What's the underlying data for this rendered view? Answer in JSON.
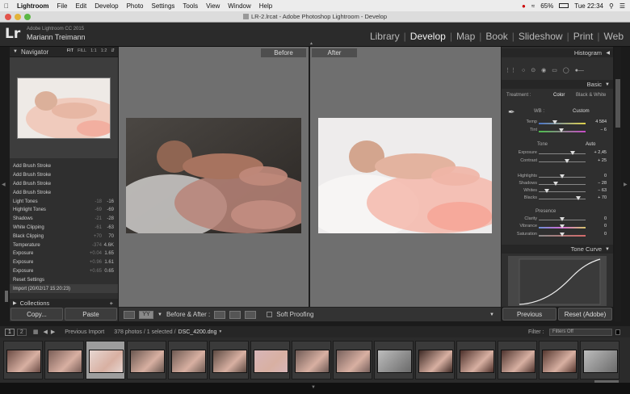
{
  "menubar": {
    "app": "Lightroom",
    "items": [
      "File",
      "Edit",
      "Develop",
      "Photo",
      "Settings",
      "Tools",
      "View",
      "Window",
      "Help"
    ],
    "battery": "65%",
    "clock": "Tue 22:34"
  },
  "window": {
    "title": "LR-2.lrcat - Adobe Photoshop Lightroom - Develop"
  },
  "identity": {
    "logo": "Lr",
    "version": "Adobe Lightroom CC 2015",
    "user": "Mariann Treimann",
    "modules": [
      "Library",
      "Develop",
      "Map",
      "Book",
      "Slideshow",
      "Print",
      "Web"
    ],
    "active_module": "Develop"
  },
  "navigator": {
    "title": "Navigator",
    "zoom_options": [
      "FIT",
      "FILL",
      "1:1",
      "1:2"
    ]
  },
  "history": [
    {
      "label": "Add Brush Stroke",
      "v1": "",
      "v2": ""
    },
    {
      "label": "Add Brush Stroke",
      "v1": "",
      "v2": ""
    },
    {
      "label": "Add Brush Stroke",
      "v1": "",
      "v2": ""
    },
    {
      "label": "Add Brush Stroke",
      "v1": "",
      "v2": ""
    },
    {
      "label": "Light Tones",
      "v1": "-18",
      "v2": "-16"
    },
    {
      "label": "Highlight Tones",
      "v1": "-69",
      "v2": "-69"
    },
    {
      "label": "Shadows",
      "v1": "-21",
      "v2": "-28"
    },
    {
      "label": "White Clipping",
      "v1": "-61",
      "v2": "-63"
    },
    {
      "label": "Black Clipping",
      "v1": "+70",
      "v2": "70"
    },
    {
      "label": "Temperature",
      "v1": "-374",
      "v2": "4.6K"
    },
    {
      "label": "Exposure",
      "v1": "+0.04",
      "v2": "1.65"
    },
    {
      "label": "Exposure",
      "v1": "+0.96",
      "v2": "1.61"
    },
    {
      "label": "Exposure",
      "v1": "+0.65",
      "v2": "0.65"
    },
    {
      "label": "Reset Settings",
      "v1": "",
      "v2": ""
    },
    {
      "label": "Import (20/02/17 15:20:23)",
      "v1": "",
      "v2": ""
    }
  ],
  "collections": {
    "title": "Collections"
  },
  "left_buttons": {
    "copy": "Copy...",
    "paste": "Paste"
  },
  "compare": {
    "before": "Before",
    "after": "After"
  },
  "toolbar": {
    "before_after": "Before & After :",
    "soft_proofing": "Soft Proofing"
  },
  "histogram": {
    "title": "Histogram"
  },
  "basic": {
    "title": "Basic",
    "treatment_label": "Treatment :",
    "treatment_color": "Color",
    "treatment_bw": "Black & White",
    "wb_label": "WB :",
    "wb_value": "Custom",
    "temp_label": "Temp",
    "temp_value": "4 584",
    "temp_pos": 0.35,
    "tint_label": "Tint",
    "tint_value": "− 6",
    "tint_pos": 0.48,
    "tone_label": "Tone",
    "auto": "Auto",
    "sliders": [
      {
        "label": "Exposure",
        "value": "+ 2,45",
        "pos": 0.72
      },
      {
        "label": "Contrast",
        "value": "+ 25",
        "pos": 0.6
      },
      {
        "label": "Highlights",
        "value": "0",
        "pos": 0.5
      },
      {
        "label": "Shadows",
        "value": "− 28",
        "pos": 0.36
      },
      {
        "label": "Whites",
        "value": "− 63",
        "pos": 0.18
      },
      {
        "label": "Blacks",
        "value": "+ 70",
        "pos": 0.85
      }
    ],
    "presence_label": "Presence",
    "presence": [
      {
        "label": "Clarity",
        "value": "0",
        "pos": 0.5
      },
      {
        "label": "Vibrance",
        "value": "0",
        "pos": 0.5
      },
      {
        "label": "Saturation",
        "value": "0",
        "pos": 0.5
      }
    ]
  },
  "tone_curve": {
    "title": "Tone Curve"
  },
  "right_buttons": {
    "previous": "Previous",
    "reset": "Reset (Adobe)"
  },
  "filmstrip": {
    "page1": "1",
    "page2": "2",
    "source": "Previous Import",
    "count": "378 photos / 1 selected /",
    "filename": "DSC_4200.dng",
    "filter_label": "Filter :",
    "filter_value": "Filters Off"
  },
  "colors": {
    "accent": "#dddddd",
    "panel": "#2f2f2f",
    "canvas": "#6f6f6f"
  }
}
